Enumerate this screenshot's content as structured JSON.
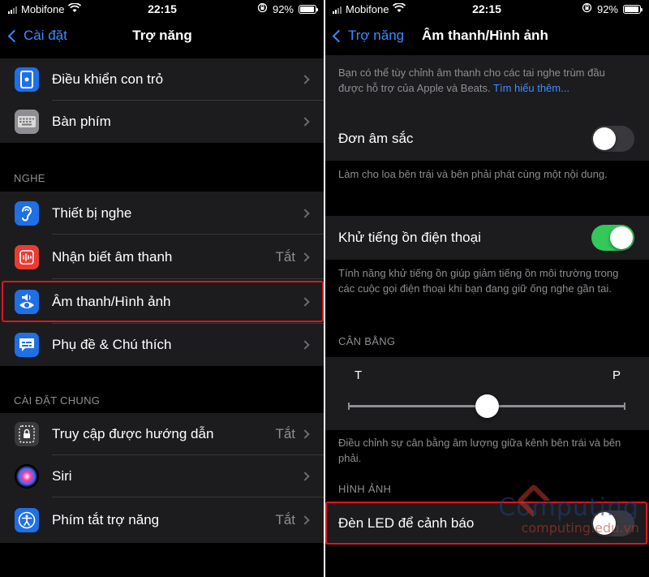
{
  "left": {
    "status": {
      "carrier": "Mobifone",
      "time": "22:15",
      "battery": "92%"
    },
    "nav": {
      "back": "Cài đặt",
      "title": "Trợ năng"
    },
    "top_items": [
      {
        "label": "Điều khiển con trỏ",
        "icon": "pointer-control-icon"
      },
      {
        "label": "Bàn phím",
        "icon": "keyboard-icon"
      }
    ],
    "section_hearing": "NGHE",
    "hearing_items": [
      {
        "label": "Thiết bị nghe",
        "icon": "ear-icon",
        "value": ""
      },
      {
        "label": "Nhận biết âm thanh",
        "icon": "sound-recognition-icon",
        "value": "Tắt"
      },
      {
        "label": "Âm thanh/Hình ảnh",
        "icon": "audio-visual-icon",
        "value": ""
      },
      {
        "label": "Phụ đề & Chú thích",
        "icon": "subtitles-icon",
        "value": ""
      }
    ],
    "section_general": "CÀI ĐẶT CHUNG",
    "general_items": [
      {
        "label": "Truy cập được hướng dẫn",
        "icon": "guided-access-icon",
        "value": "Tắt"
      },
      {
        "label": "Siri",
        "icon": "siri-icon",
        "value": ""
      },
      {
        "label": "Phím tắt trợ năng",
        "icon": "accessibility-icon",
        "value": "Tắt"
      }
    ]
  },
  "right": {
    "status": {
      "carrier": "Mobifone",
      "time": "22:15",
      "battery": "92%"
    },
    "nav": {
      "back": "Trợ năng",
      "title": "Âm thanh/Hình ảnh"
    },
    "intro_text": "Bạn có thể tùy chỉnh âm thanh cho các tai nghe trùm đầu được hỗ trợ của Apple và Beats.",
    "intro_link": "Tìm hiểu thêm...",
    "mono_label": "Đơn âm sắc",
    "mono_on": false,
    "mono_note": "Làm cho loa bên trái và bên phải phát cùng một nội dung.",
    "noise_label": "Khử tiếng ồn điện thoại",
    "noise_on": true,
    "noise_note": "Tính năng khử tiếng ồn giúp giảm tiếng ồn môi trường trong các cuộc gọi điện thoại khi bạn đang giữ ống nghe gần tai.",
    "balance_head": "CÂN BẰNG",
    "balance_left": "T",
    "balance_right": "P",
    "balance_value": 0.5,
    "balance_note": "Điều chỉnh sự cân bằng âm lượng giữa kênh bên trái và bên phải.",
    "visual_head": "HÌNH ẢNH",
    "led_label": "Đèn LED để cảnh báo",
    "led_on": false
  },
  "watermark": {
    "title": "Computing",
    "url": "computing.edu.vn"
  },
  "colors": {
    "accent": "#3d8cff",
    "toggle_on": "#34c759",
    "highlight": "#e0141e"
  }
}
